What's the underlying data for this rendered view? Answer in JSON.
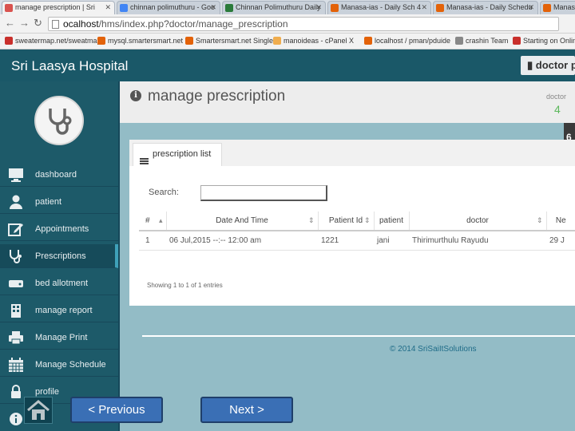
{
  "browser": {
    "tabs": [
      {
        "title": "manage prescription | Sri",
        "active": true,
        "favicon_color": "#d9534f"
      },
      {
        "title": "chinnan polimuthuru - Goo",
        "active": false,
        "favicon_color": "#4285f4"
      },
      {
        "title": "Chinnan Polimuthuru Daily",
        "active": false,
        "favicon_color": "#2a7a3a"
      },
      {
        "title": "Manasa-ias - Daily Sch 4",
        "active": false,
        "favicon_color": "#e36209"
      },
      {
        "title": "Manasa-ias - Daily Schedu",
        "active": false,
        "favicon_color": "#e36209"
      },
      {
        "title": "Manasa-ias - Daily Schedu",
        "active": false,
        "favicon_color": "#e36209"
      }
    ],
    "url_host": "ocalhost",
    "url_path": "/hms/index.php?doctor/manage_prescription",
    "bookmarks": [
      {
        "label": "sweatermap.net/sweatmap",
        "color": "#c9302c"
      },
      {
        "label": "mysql.smartersmart.net",
        "color": "#e36209"
      },
      {
        "label": "Smartersmart.net Single",
        "color": "#e36209"
      },
      {
        "label": "manoideas - cPanel X",
        "color": "#f0ad4e"
      },
      {
        "label": "localhost / pman/pduide",
        "color": "#e36209"
      },
      {
        "label": "crashin Team",
        "color": "#888888"
      },
      {
        "label": "Starting on Online",
        "color": "#c9302c"
      }
    ]
  },
  "header": {
    "brand": "Sri Laasya Hospital",
    "user": "doctor pa"
  },
  "sidebar": {
    "items": [
      {
        "label": "dashboard",
        "icon": "monitor-icon"
      },
      {
        "label": "patient",
        "icon": "user-icon"
      },
      {
        "label": "Appointments",
        "icon": "edit-icon"
      },
      {
        "label": "Prescriptions",
        "icon": "stethoscope-icon",
        "active": true
      },
      {
        "label": "bed allotment",
        "icon": "hdd-icon"
      },
      {
        "label": "manage report",
        "icon": "building-icon"
      },
      {
        "label": "Manage Print",
        "icon": "print-icon"
      },
      {
        "label": "Manage Schedule",
        "icon": "calendar-icon"
      },
      {
        "label": "profile",
        "icon": "lock-icon"
      }
    ]
  },
  "main": {
    "title": "manage prescription",
    "doctor_label": "doctor",
    "doctor_count": "4",
    "edge_tag": "6",
    "panel_tab": "prescription list",
    "search_label": "Search:",
    "search_value": "",
    "table": {
      "headers": [
        "#",
        "Date And Time",
        "Patient Id",
        "patient",
        "doctor",
        "Ne"
      ],
      "rows": [
        [
          "1",
          "06 Jul,2015 --:-- 12:00 am",
          "1221",
          "jani",
          "Thirimurthulu Rayudu",
          "29 J"
        ]
      ]
    },
    "info": "Showing 1 to 1 of 1 entries",
    "footer": "© 2014 SriSaiItSolutions"
  },
  "presentation": {
    "prev_label": "< Previous",
    "next_label": "Next >"
  }
}
